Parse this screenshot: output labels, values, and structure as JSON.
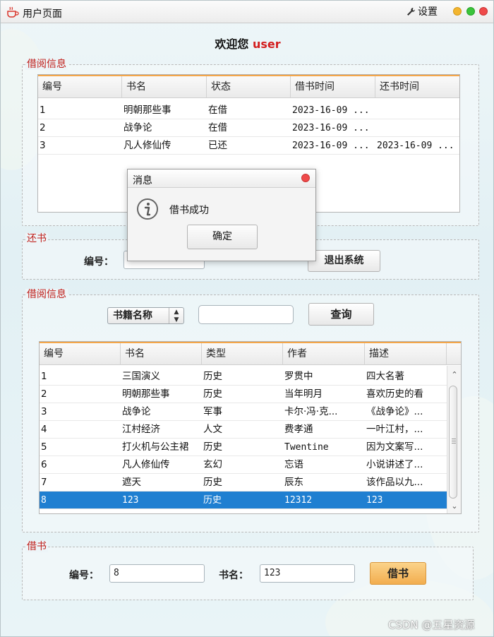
{
  "window": {
    "title": "用户页面",
    "settings_label": "设置"
  },
  "welcome": {
    "prefix": "欢迎您",
    "username": "user"
  },
  "borrow_info_top": {
    "title": "借阅信息",
    "columns": [
      "编号",
      "书名",
      "状态",
      "借书时间",
      "还书时间"
    ],
    "rows": [
      [
        "1",
        "明朝那些事",
        "在借",
        "2023-16-09 ...",
        ""
      ],
      [
        "2",
        "战争论",
        "在借",
        "2023-16-09 ...",
        ""
      ],
      [
        "3",
        "凡人修仙传",
        "已还",
        "2023-16-09 ...",
        "2023-16-09 ..."
      ]
    ]
  },
  "return_book": {
    "title": "还书",
    "id_label": "编号：",
    "id_value": "",
    "logout_label": "退出系统"
  },
  "borrow_info_bottom": {
    "title": "借阅信息",
    "filter_option": "书籍名称",
    "search_value": "",
    "query_label": "查询",
    "columns": [
      "编号",
      "书名",
      "类型",
      "作者",
      "描述"
    ],
    "rows": [
      [
        "1",
        "三国演义",
        "历史",
        "罗贯中",
        "四大名著"
      ],
      [
        "2",
        "明朝那些事",
        "历史",
        "当年明月",
        "喜欢历史的看"
      ],
      [
        "3",
        "战争论",
        "军事",
        "卡尔·冯·克...",
        "《战争论》..."
      ],
      [
        "4",
        "江村经济",
        "人文",
        "费孝通",
        "一叶江村，..."
      ],
      [
        "5",
        "打火机与公主裙",
        "历史",
        "Twentine",
        "因为文案写..."
      ],
      [
        "6",
        "凡人修仙传",
        "玄幻",
        "忘语",
        "小说讲述了..."
      ],
      [
        "7",
        "遮天",
        "历史",
        "辰东",
        "该作品以九..."
      ],
      [
        "8",
        "123",
        "历史",
        "12312",
        "123"
      ]
    ],
    "selected_row": 7
  },
  "borrow_form": {
    "title": "借书",
    "id_label": "编号：",
    "id_value": "8",
    "name_label": "书名：",
    "name_value": "123",
    "borrow_label": "借书"
  },
  "dialog": {
    "title": "消息",
    "message": "借书成功",
    "ok_label": "确定"
  },
  "watermark": "CSDN @五星资源",
  "colors": {
    "accent_header": "#f3a64a",
    "selected_row": "#1f7fd1",
    "group_title": "#c0201b",
    "username": "#d31e1e",
    "borrow_button": "#f2ad4e"
  },
  "icons": {
    "app": "coffee-cup-icon",
    "settings": "wrench-icon",
    "dialog": "info-icon"
  }
}
